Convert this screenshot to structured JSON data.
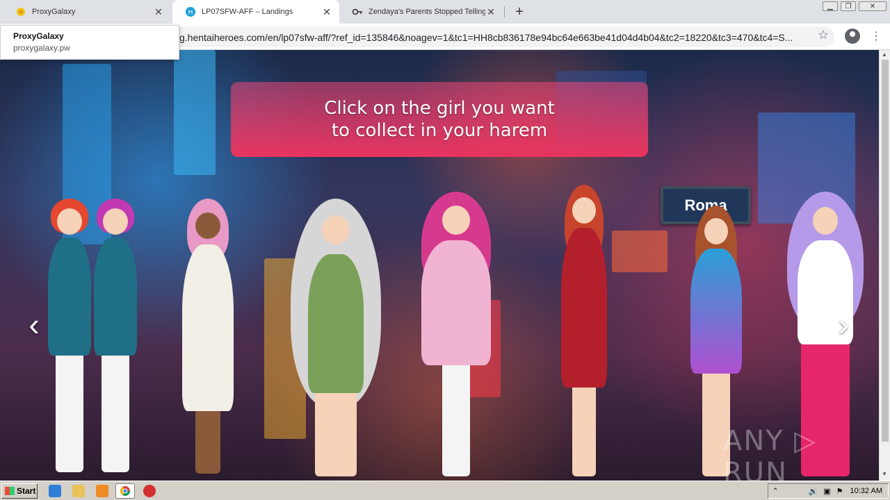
{
  "tabs": [
    {
      "title": "ProxyGalaxy",
      "icon": "proxygalaxy-icon"
    },
    {
      "title": "LP07SFW-AFF – Landings",
      "icon": "hh-logo-icon"
    },
    {
      "title": "Zendaya's Parents Stopped Telling H",
      "icon": "key-icon"
    }
  ],
  "omnibox": {
    "url": "g.hentaiheroes.com/en/lp07sfw-aff/?ref_id=135846&noagev=1&tc1=HH8cb836178e94bc64e663be41d04d4b04&tc2=18220&tc3=470&tc4=S..."
  },
  "popup": {
    "title": "ProxyGalaxy",
    "subtitle": "proxygalaxy.pw"
  },
  "page": {
    "banner_line1": "Click on the girl you want",
    "banner_line2": "to collect in your harem",
    "sign_text": "Roma",
    "watermark": "ANY ▷ RUN"
  },
  "taskbar": {
    "start_label": "Start",
    "clock": "10:32 AM"
  },
  "colors": {
    "banner_pink": "#e8345f",
    "sign_blue": "#20375a"
  }
}
